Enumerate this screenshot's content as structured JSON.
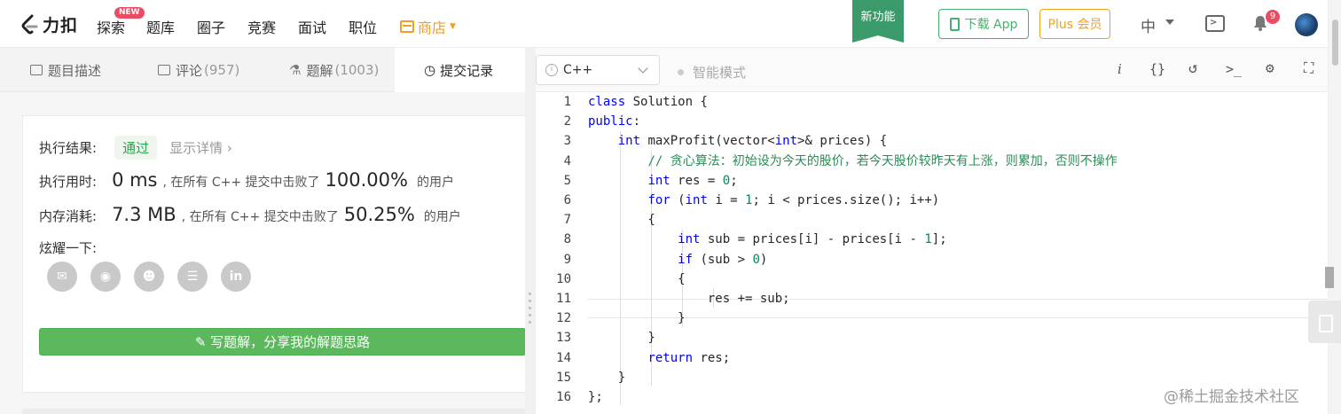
{
  "nav": {
    "logo_text": "力扣",
    "items": [
      "探索",
      "题库",
      "圈子",
      "竞赛",
      "面试",
      "职位"
    ],
    "new_badge": "NEW",
    "shop": "商店",
    "new_feature": "新功能",
    "download_app": "下载 App",
    "plus_member": "Plus 会员",
    "language": "中",
    "notification_count": "9"
  },
  "left_tabs": {
    "description": "题目描述",
    "comments": "评论",
    "comments_count": "(957)",
    "solutions": "题解",
    "solutions_count": "(1003)",
    "submissions": "提交记录"
  },
  "result": {
    "label": "执行结果:",
    "status": "通过",
    "details_link": "显示详情 ›",
    "runtime_label": "执行用时:",
    "runtime_value": "0 ms",
    "runtime_mid": ", 在所有 C++ 提交中击败了",
    "runtime_percent": "100.00%",
    "runtime_suffix": "的用户",
    "memory_label": "内存消耗:",
    "memory_value": "7.3 MB",
    "memory_mid": ", 在所有 C++ 提交中击败了",
    "memory_percent": "50.25%",
    "memory_suffix": "的用户",
    "share_label": "炫耀一下:",
    "share_icons": [
      "wechat-icon",
      "weibo-icon",
      "qq-icon",
      "douban-icon",
      "linkedin-icon"
    ],
    "write_button": "✎ 写题解，分享我的解题思路"
  },
  "editor": {
    "language": "C++",
    "smart_mode": "智能模式",
    "line_numbers": [
      "1",
      "2",
      "3",
      "4",
      "5",
      "6",
      "7",
      "8",
      "9",
      "10",
      "11",
      "12",
      "13",
      "14",
      "15",
      "16"
    ],
    "lines": [
      "class Solution {",
      "public:",
      "    int maxProfit(vector<int>& prices) {",
      "        // 贪心算法：初始设为今天的股价，若今天股价较昨天有上涨，则累加，否则不操作",
      "        int res = 0;",
      "        for (int i = 1; i < prices.size(); i++)",
      "        {",
      "            int sub = prices[i] - prices[i - 1];",
      "            if (sub > 0)",
      "            {",
      "                res += sub;",
      "            }",
      "        }",
      "        return res;",
      "    }",
      "};"
    ]
  },
  "watermark": "@稀土掘金技术社区"
}
